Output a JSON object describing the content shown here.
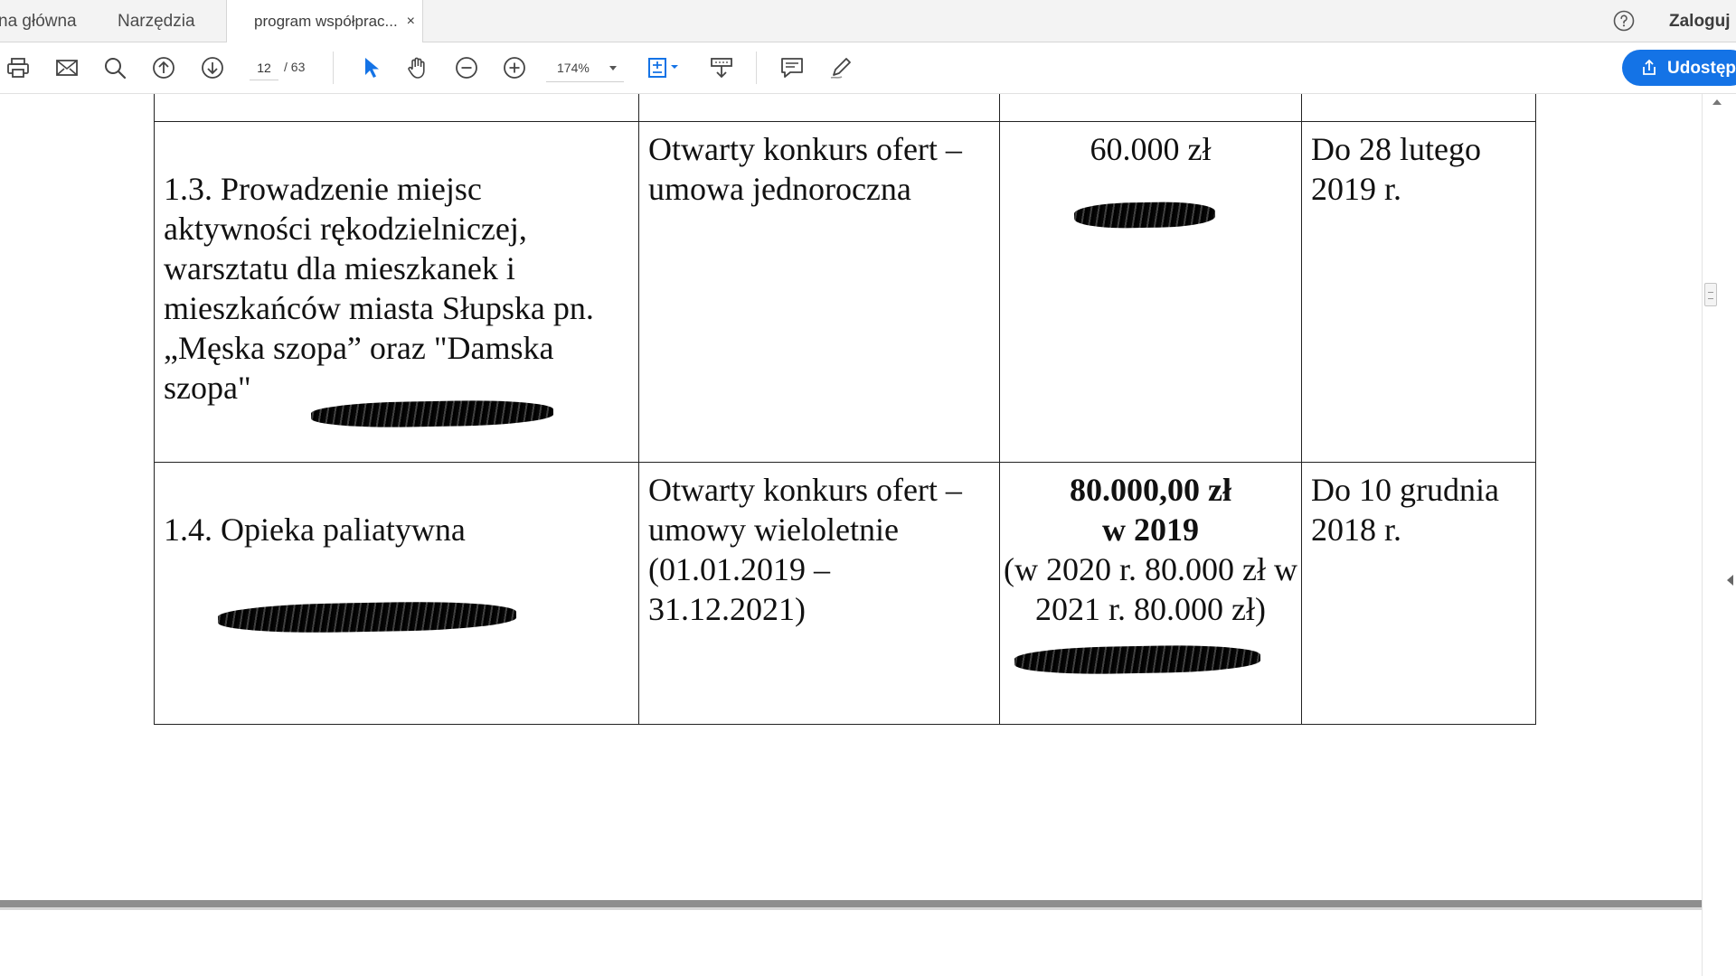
{
  "tabs": [
    {
      "label": "na główna"
    },
    {
      "label": "Narzędzia"
    },
    {
      "label": "program współprac...",
      "active": true,
      "close": "×"
    }
  ],
  "header": {
    "login_label": "Zaloguj"
  },
  "toolbar": {
    "current_page": "12",
    "total_pages": "/ 63",
    "zoom": "174%",
    "share_label": "Udostęp",
    "icons": [
      "print-icon",
      "mail-icon",
      "search-icon",
      "arrow-up-circle-icon",
      "arrow-down-circle-icon",
      "select-cursor-icon",
      "hand-icon",
      "zoom-out-icon",
      "zoom-in-icon",
      "fit-page-icon",
      "scroll-mode-icon",
      "comment-icon",
      "pen-icon",
      "help-icon",
      "share-icon"
    ]
  },
  "colors": {
    "accent": "#1473e6",
    "tab_bar": "#f3f3f3"
  },
  "document": {
    "rows": [
      {
        "task": "1.3. Prowadzenie miejsc aktywności rękodzielniczej, warsztatu dla  mieszkanek i mieszkańców miasta Słupska pn. „Męska szopa” oraz \"Damska szopa\"",
        "mode": "Otwarty konkurs ofert – umowa jednoroczna",
        "amount": "60.000 zł",
        "deadline": "Do 28 lutego 2019 r."
      },
      {
        "task": "1.4. Opieka paliatywna",
        "mode": "Otwarty konkurs ofert – umowy wieloletnie (01.01.2019 – 31.12.2021)",
        "amount_line1": "80.000,00 zł",
        "amount_line2": "w 2019",
        "amount_line3": "(w 2020 r. 80.000 zł w 2021 r. 80.000 zł)",
        "deadline": "Do 10 grudnia 2018 r."
      }
    ]
  }
}
